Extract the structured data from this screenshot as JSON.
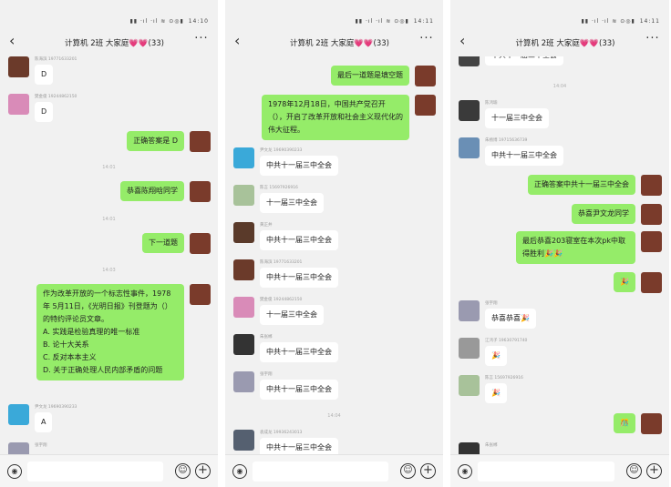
{
  "status": {
    "time_1": "14:10",
    "time_2": "14:11",
    "time_3": "14:11"
  },
  "chat": {
    "title": "计算机 2班 大家庭💗💗(33)"
  },
  "panels": [
    {
      "messages": [
        {
          "type": "in",
          "sender": "陈海滨 19771633201",
          "text": "D",
          "avatar": "#6b3a2a"
        },
        {
          "type": "in",
          "sender": "樊金俊 19244862150",
          "text": "D",
          "avatar": "#d98bb8"
        },
        {
          "type": "out",
          "text": "正确答案是 D",
          "avatar": "#7a3b2b"
        },
        {
          "type": "time",
          "text": "14:01"
        },
        {
          "type": "out",
          "text": "恭喜陈翔晗同学",
          "avatar": "#7a3b2b"
        },
        {
          "type": "time",
          "text": "14:01"
        },
        {
          "type": "out",
          "text": "下一道题",
          "avatar": "#7a3b2b"
        },
        {
          "type": "time",
          "text": "14:03"
        },
        {
          "type": "out",
          "text": "作为改革开放的一个标志性事件，1978年 5月11日，《光明日报》刊登题为（）的特约评论员文章。\nA. 实践是检验真理的唯一标准\nB. 论十大关系\nC. 反对本本主义\nD. 关于正确处理人民内部矛盾的问题",
          "avatar": "#7a3b2b"
        },
        {
          "type": "in",
          "sender": "尹文龙 19690390233",
          "text": "A",
          "avatar": "#3aa9d9"
        },
        {
          "type": "in",
          "sender": "张宇翔",
          "text": "",
          "avatar": "#9a9ab0"
        }
      ]
    },
    {
      "messages": [
        {
          "type": "out",
          "text": "最后一道题是填空题",
          "avatar": "#7a3b2b"
        },
        {
          "type": "out",
          "text": "1978年12月18日，中国共产党召开（），开启了改革开放和社会主义现代化的伟大征程。",
          "avatar": "#7a3b2b"
        },
        {
          "type": "in",
          "sender": "尹文龙 19690390233",
          "text": "中共十一届三中全会",
          "avatar": "#3aa9d9"
        },
        {
          "type": "in",
          "sender": "陈言 15697926916",
          "text": "十一届三中全会",
          "avatar": "#a8c29a"
        },
        {
          "type": "in",
          "sender": "黄正井",
          "text": "中共十一届三中全会",
          "avatar": "#5a3a2a"
        },
        {
          "type": "in",
          "sender": "陈海滨 19771633201",
          "text": "中共十一届三中全会",
          "avatar": "#6b3a2a"
        },
        {
          "type": "in",
          "sender": "樊金俊 19244862150",
          "text": "十一届三中全会",
          "avatar": "#d98bb8"
        },
        {
          "type": "in",
          "sender": "朱张郴",
          "text": "中共十一届三中全会",
          "avatar": "#333333"
        },
        {
          "type": "in",
          "sender": "张宇翔",
          "text": "中共十一届三中全会",
          "avatar": "#9a9ab0"
        },
        {
          "type": "time",
          "text": "14:04"
        },
        {
          "type": "in",
          "sender": "袁成龙 19936243013",
          "text": "中共十一届三中全会",
          "avatar": "#556070"
        }
      ]
    },
    {
      "messages": [
        {
          "type": "in",
          "sender": "",
          "text": "中共十一届三中全会",
          "avatar": "#444444"
        },
        {
          "type": "time",
          "text": "14:04"
        },
        {
          "type": "in",
          "sender": "陈鸿瑜",
          "text": "十一届三中全会",
          "avatar": "#3a3a3a"
        },
        {
          "type": "in",
          "sender": "朱杨博 19715636739",
          "text": "中共十一届三中全会",
          "avatar": "#6a8fb5"
        },
        {
          "type": "out",
          "text": "正确答案中共十一届三中全会",
          "avatar": "#7a3b2b"
        },
        {
          "type": "out",
          "text": "恭喜尹文龙同学",
          "avatar": "#7a3b2b"
        },
        {
          "type": "out",
          "text": "最后恭喜203寝室在本次pk中取得胜利🎉🎉",
          "avatar": "#7a3b2b"
        },
        {
          "type": "out",
          "text": "🎉",
          "avatar": "#7a3b2b"
        },
        {
          "type": "in",
          "sender": "张宇翔",
          "text": "恭喜恭喜🎉",
          "avatar": "#9a9ab0"
        },
        {
          "type": "in",
          "sender": "江鸿子 19630791740",
          "text": "🎉",
          "avatar": "#999999"
        },
        {
          "type": "in",
          "sender": "陈言 15697926916",
          "text": "🎉",
          "avatar": "#a8c29a"
        },
        {
          "type": "out",
          "text": "🎊",
          "avatar": "#7a3b2b"
        },
        {
          "type": "in",
          "sender": "朱张郴",
          "text": "",
          "avatar": "#333333"
        }
      ]
    }
  ],
  "input": {
    "placeholder": ""
  },
  "icons": {
    "back": "chevron-left-icon",
    "more": "more-dots-icon",
    "voice": "voice-icon",
    "emoji": "emoji-icon",
    "plus": "plus-icon"
  }
}
